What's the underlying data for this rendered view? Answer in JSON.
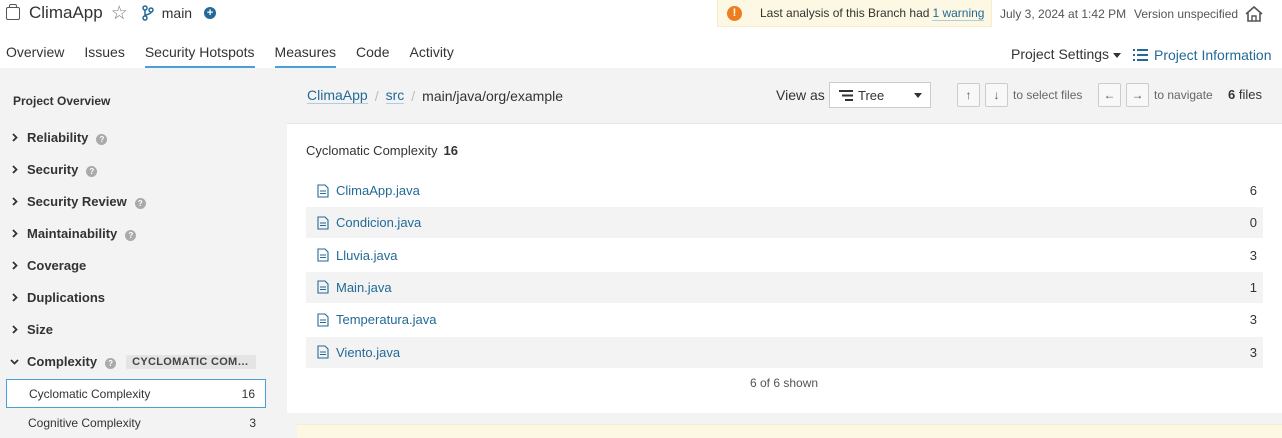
{
  "project": {
    "name": "ClimaApp",
    "branch": "main"
  },
  "warning": {
    "text": "Last analysis of this Branch had",
    "link": "1 warning"
  },
  "analysis_date": "July 3, 2024 at 1:42 PM",
  "version": "Version unspecified",
  "nav": {
    "tabs": [
      "Overview",
      "Issues",
      "Security Hotspots",
      "Measures",
      "Code",
      "Activity"
    ],
    "active": "Measures",
    "project_settings": "Project Settings",
    "project_information": "Project Information"
  },
  "sidebar": {
    "title": "Project Overview",
    "items": [
      {
        "label": "Reliability",
        "help": true
      },
      {
        "label": "Security",
        "help": true
      },
      {
        "label": "Security Review",
        "help": true
      },
      {
        "label": "Maintainability",
        "help": true
      },
      {
        "label": "Coverage",
        "help": false
      },
      {
        "label": "Duplications",
        "help": false
      },
      {
        "label": "Size",
        "help": false
      },
      {
        "label": "Complexity",
        "help": true,
        "badge": "CYCLOMATIC COMPLEXITY",
        "expanded": true
      }
    ],
    "subitems": [
      {
        "label": "Cyclomatic Complexity",
        "value": "16",
        "selected": true
      },
      {
        "label": "Cognitive Complexity",
        "value": "3",
        "selected": false
      }
    ]
  },
  "breadcrumb": {
    "root": "ClimaApp",
    "dir": "src",
    "current": "main/java/org/example"
  },
  "view_as": {
    "label": "View as",
    "value": "Tree"
  },
  "keyboard": {
    "up": "↑",
    "down": "↓",
    "select_hint": "to select files",
    "left": "←",
    "right": "→",
    "navigate_hint": "to navigate"
  },
  "files_count": {
    "count": "6",
    "label": "files"
  },
  "metric": {
    "name": "Cyclomatic Complexity",
    "value": "16"
  },
  "files": [
    {
      "name": "ClimaApp.java",
      "value": "6"
    },
    {
      "name": "Condicion.java",
      "value": "0"
    },
    {
      "name": "Lluvia.java",
      "value": "3"
    },
    {
      "name": "Main.java",
      "value": "1"
    },
    {
      "name": "Temperatura.java",
      "value": "3"
    },
    {
      "name": "Viento.java",
      "value": "3"
    }
  ],
  "shown": "6 of 6 shown",
  "colors": {
    "link": "#236a97",
    "accent": "#4b9fd5",
    "warning_bg": "#fcf8e3",
    "warning_icon": "#ed7d20",
    "sidebar_bg": "#f3f3f3"
  }
}
